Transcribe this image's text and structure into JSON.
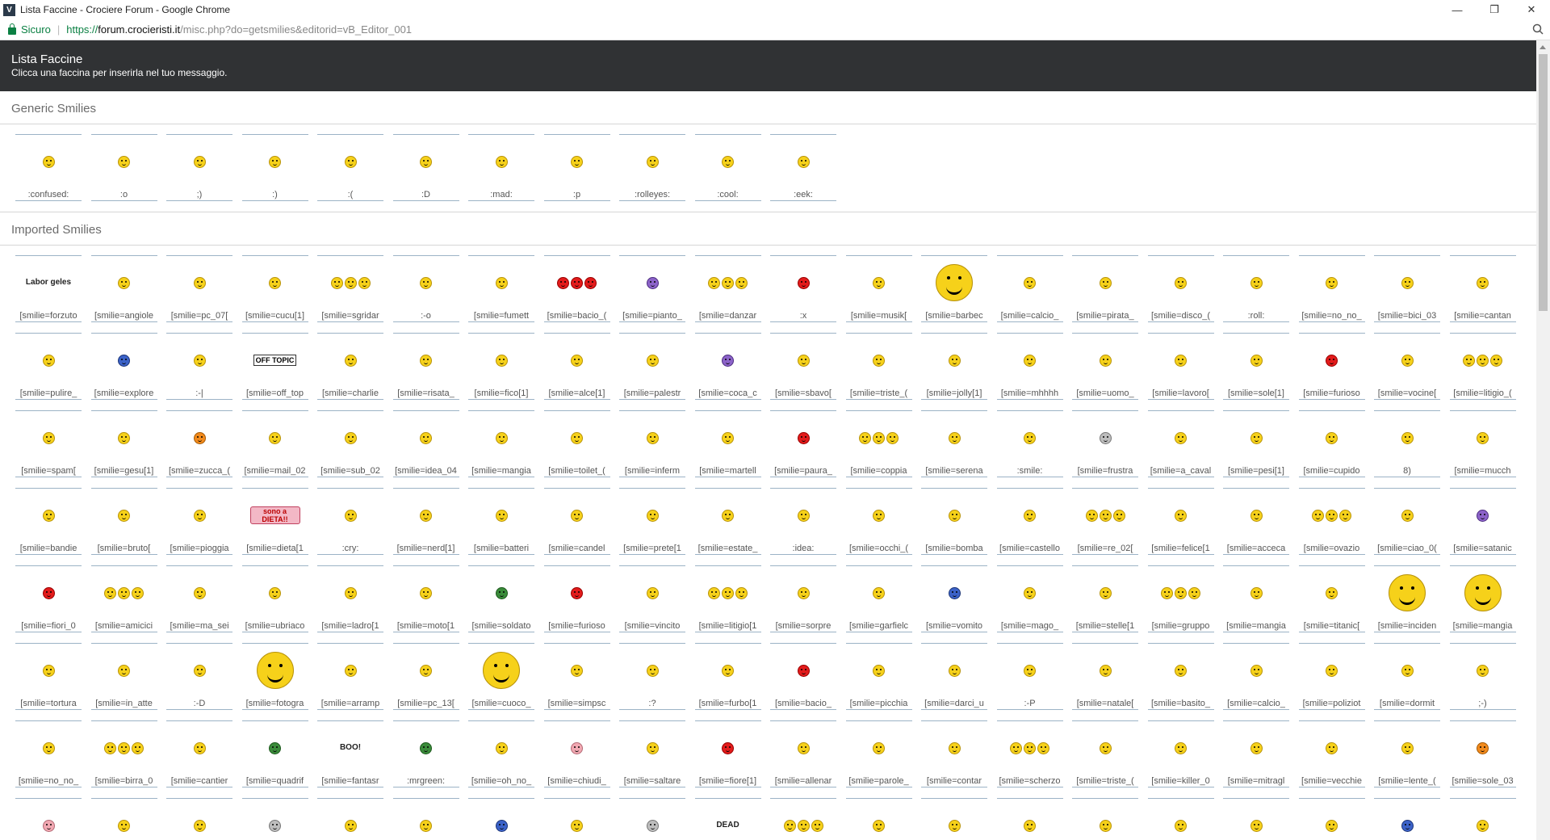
{
  "window": {
    "title": "Lista Faccine - Crociere Forum - Google Chrome",
    "app_icon": "V"
  },
  "addressbar": {
    "secure_label": "Sicuro",
    "url_scheme": "https://",
    "url_host": "forum.crocieristi.it",
    "url_path": "/misc.php?do=getsmilies&editorid=vB_Editor_001"
  },
  "header": {
    "title": "Lista Faccine",
    "subtitle": "Clicca una faccina per inserirla nel tuo messaggio."
  },
  "sections": [
    {
      "title": "Generic Smilies",
      "items": [
        {
          "code": ":confused:",
          "icon": "confused-smiley-icon"
        },
        {
          "code": ":o",
          "icon": "surprised-smiley-icon"
        },
        {
          "code": ";)",
          "icon": "wink-smiley-icon"
        },
        {
          "code": ":)",
          "icon": "smile-smiley-icon"
        },
        {
          "code": ":(",
          "icon": "frown-smiley-icon"
        },
        {
          "code": ":D",
          "icon": "grin-smiley-icon"
        },
        {
          "code": ":mad:",
          "icon": "mad-smiley-icon"
        },
        {
          "code": ":p",
          "icon": "tongue-smiley-icon"
        },
        {
          "code": ":rolleyes:",
          "icon": "rolleyes-smiley-icon"
        },
        {
          "code": ":cool:",
          "icon": "cool-smiley-icon"
        },
        {
          "code": ":eek:",
          "icon": "eek-smiley-icon"
        }
      ]
    },
    {
      "title": "Imported Smilies",
      "items": [
        {
          "code": "[smilie=forzuto",
          "icon": "laborgeles-smiley-icon",
          "text": "Labor geles"
        },
        {
          "code": "[smilie=angiole",
          "icon": "angel-smiley-icon"
        },
        {
          "code": "[smilie=pc_07[",
          "icon": "computer-smiley-icon"
        },
        {
          "code": "[smilie=cucu[1]",
          "icon": "cuckoo-clock-icon"
        },
        {
          "code": "[smilie=sgridar",
          "icon": "scolding-smileys-icon"
        },
        {
          "code": ":-o",
          "icon": "surprised-smiley-icon"
        },
        {
          "code": "[smilie=fumett",
          "icon": "comic-smiley-icon"
        },
        {
          "code": "[smilie=bacio_(",
          "icon": "kiss-smileys-icon"
        },
        {
          "code": "[smilie=pianto_",
          "icon": "crying-smiley-icon"
        },
        {
          "code": "[smilie=danzar",
          "icon": "dancing-smileys-icon"
        },
        {
          "code": ":x",
          "icon": "angry-smiley-icon"
        },
        {
          "code": "[smilie=musik[",
          "icon": "music-smiley-icon"
        },
        {
          "code": "[smilie=barbec",
          "icon": "barbecue-smiley-icon"
        },
        {
          "code": "[smilie=calcio_",
          "icon": "soccer-smiley-icon"
        },
        {
          "code": "[smilie=pirata_",
          "icon": "pirate-smiley-icon"
        },
        {
          "code": "[smilie=disco_(",
          "icon": "disco-smiley-icon"
        },
        {
          "code": ":roll:",
          "icon": "roll-eyes-smiley-icon"
        },
        {
          "code": "[smilie=no_no_",
          "icon": "no-no-smiley-icon"
        },
        {
          "code": "[smilie=bici_03",
          "icon": "bicycle-smiley-icon"
        },
        {
          "code": "[smilie=cantan",
          "icon": "singing-smiley-icon"
        },
        {
          "code": "[smilie=pulire_",
          "icon": "picture-frame-icon"
        },
        {
          "code": "[smilie=explore",
          "icon": "explorer-globe-icon"
        },
        {
          "code": ":-|",
          "icon": "neutral-smiley-icon"
        },
        {
          "code": "[smilie=off_top",
          "icon": "off-topic-sign-icon",
          "text": "OFF TOPIC"
        },
        {
          "code": "[smilie=charlie",
          "icon": "charlie-chaplin-smiley-icon"
        },
        {
          "code": "[smilie=risata_",
          "icon": "laughing-smiley-icon"
        },
        {
          "code": "[smilie=fico[1]",
          "icon": "cool-smiley-icon"
        },
        {
          "code": "[smilie=alce[1]",
          "icon": "moose-smiley-icon"
        },
        {
          "code": "[smilie=palestr",
          "icon": "gym-smiley-icon"
        },
        {
          "code": "[smilie=coca_c",
          "icon": "cola-smiley-icon"
        },
        {
          "code": "[smilie=sbavo[",
          "icon": "drool-smiley-icon"
        },
        {
          "code": "[smilie=triste_(",
          "icon": "sad-smiley-icon"
        },
        {
          "code": "[smilie=jolly[1]",
          "icon": "jester-smiley-icon"
        },
        {
          "code": "[smilie=mhhhh",
          "icon": "thinking-smiley-icon"
        },
        {
          "code": "[smilie=uomo_",
          "icon": "man-smiley-icon"
        },
        {
          "code": "[smilie=lavoro[",
          "icon": "working-smiley-icon"
        },
        {
          "code": "[smilie=sole[1]",
          "icon": "sun-smiley-icon"
        },
        {
          "code": "[smilie=furioso",
          "icon": "furious-smiley-icon"
        },
        {
          "code": "[smilie=vocine[",
          "icon": "voices-smiley-icon"
        },
        {
          "code": "[smilie=litigio_(",
          "icon": "fight-smileys-icon"
        },
        {
          "code": "[smilie=spam[",
          "icon": "spam-smiley-icon"
        },
        {
          "code": "[smilie=gesu[1]",
          "icon": "jesus-smiley-icon"
        },
        {
          "code": "[smilie=zucca_(",
          "icon": "pumpkin-icon"
        },
        {
          "code": "[smilie=mail_02",
          "icon": "mail-smiley-icon"
        },
        {
          "code": "[smilie=sub_02",
          "icon": "submarine-smiley-icon"
        },
        {
          "code": "[smilie=idea_04",
          "icon": "idea-smiley-icon"
        },
        {
          "code": "[smilie=mangia",
          "icon": "eating-smiley-icon"
        },
        {
          "code": "[smilie=toilet_(",
          "icon": "toilet-smiley-icon"
        },
        {
          "code": "[smilie=inferm",
          "icon": "nurse-smiley-icon"
        },
        {
          "code": "[smilie=martell",
          "icon": "hammer-smiley-icon"
        },
        {
          "code": "[smilie=paura_",
          "icon": "scared-smiley-icon"
        },
        {
          "code": "[smilie=coppia",
          "icon": "couple-smileys-icon"
        },
        {
          "code": "[smilie=serena",
          "icon": "serenade-smiley-icon"
        },
        {
          "code": ":smile:",
          "icon": "smile-smiley-icon"
        },
        {
          "code": "[smilie=frustra",
          "icon": "frustrated-smiley-icon"
        },
        {
          "code": "[smilie=a_caval",
          "icon": "horse-smiley-icon"
        },
        {
          "code": "[smilie=pesi[1]",
          "icon": "weights-smiley-icon"
        },
        {
          "code": "[smilie=cupido",
          "icon": "cupid-smiley-icon"
        },
        {
          "code": "8)",
          "icon": "cool-smiley-icon"
        },
        {
          "code": "[smilie=mucch",
          "icon": "cow-smiley-icon"
        },
        {
          "code": "[smilie=bandie",
          "icon": "flag-smiley-icon"
        },
        {
          "code": "[smilie=bruto[",
          "icon": "brute-smiley-icon"
        },
        {
          "code": "[smilie=pioggia",
          "icon": "rain-umbrella-smiley-icon"
        },
        {
          "code": "[smilie=dieta[1",
          "icon": "diet-sign-icon",
          "text": "sono a DIETA!!"
        },
        {
          "code": ":cry:",
          "icon": "cry-smiley-icon"
        },
        {
          "code": "[smilie=nerd[1]",
          "icon": "nerd-smiley-icon"
        },
        {
          "code": "[smilie=batteri",
          "icon": "drummer-smiley-icon"
        },
        {
          "code": "[smilie=candel",
          "icon": "candle-smiley-icon"
        },
        {
          "code": "[smilie=prete[1",
          "icon": "priest-smiley-icon"
        },
        {
          "code": "[smilie=estate_",
          "icon": "summer-smiley-icon"
        },
        {
          "code": ":idea:",
          "icon": "lightbulb-smiley-icon"
        },
        {
          "code": "[smilie=occhi_(",
          "icon": "eyes-smiley-icon"
        },
        {
          "code": "[smilie=bomba",
          "icon": "bomb-smiley-icon"
        },
        {
          "code": "[smilie=castello",
          "icon": "castle-icon"
        },
        {
          "code": "[smilie=re_02[",
          "icon": "king-smileys-icon"
        },
        {
          "code": "[smilie=felice[1",
          "icon": "happy-smiley-icon"
        },
        {
          "code": "[smilie=acceca",
          "icon": "blinded-smiley-icon"
        },
        {
          "code": "[smilie=ovazio",
          "icon": "ovation-smileys-icon"
        },
        {
          "code": "[smilie=ciao_0(",
          "icon": "waving-smiley-icon"
        },
        {
          "code": "[smilie=satanic",
          "icon": "devil-smiley-icon"
        },
        {
          "code": "[smilie=fiori_0",
          "icon": "flowers-smiley-icon"
        },
        {
          "code": "[smilie=amicici",
          "icon": "friends-smileys-icon"
        },
        {
          "code": "[smilie=ma_sei",
          "icon": "are-you-smiley-icon"
        },
        {
          "code": "[smilie=ubriaco",
          "icon": "drunk-smiley-icon"
        },
        {
          "code": "[smilie=ladro[1",
          "icon": "thief-smiley-icon"
        },
        {
          "code": "[smilie=moto[1",
          "icon": "motorbike-smiley-icon"
        },
        {
          "code": "[smilie=soldato",
          "icon": "soldier-smiley-icon"
        },
        {
          "code": "[smilie=furioso",
          "icon": "furious-smiley-icon"
        },
        {
          "code": "[smilie=vincito",
          "icon": "winner-smiley-icon"
        },
        {
          "code": "[smilie=litigio[1",
          "icon": "argue-smileys-icon"
        },
        {
          "code": "[smilie=sorpre",
          "icon": "surprise-smiley-icon"
        },
        {
          "code": "[smilie=garfielc",
          "icon": "garfield-icon"
        },
        {
          "code": "[smilie=vomito",
          "icon": "vomit-smiley-icon"
        },
        {
          "code": "[smilie=mago_",
          "icon": "wizard-smiley-icon"
        },
        {
          "code": "[smilie=stelle[1",
          "icon": "stars-smiley-icon"
        },
        {
          "code": "[smilie=gruppo",
          "icon": "group-smileys-icon"
        },
        {
          "code": "[smilie=mangia",
          "icon": "eating-smiley-icon"
        },
        {
          "code": "[smilie=titanic[",
          "icon": "titanic-ship-icon"
        },
        {
          "code": "[smilie=inciden",
          "icon": "accident-smiley-icon"
        },
        {
          "code": "[smilie=mangia",
          "icon": "big-eating-smiley-icon"
        },
        {
          "code": "[smilie=tortura",
          "icon": "torture-smiley-icon"
        },
        {
          "code": "[smilie=in_atte",
          "icon": "waiting-smiley-icon"
        },
        {
          "code": ":-D",
          "icon": "grin-smiley-icon"
        },
        {
          "code": "[smilie=fotogra",
          "icon": "photographer-smiley-icon"
        },
        {
          "code": "[smilie=arramp",
          "icon": "climbing-smiley-icon"
        },
        {
          "code": "[smilie=pc_13[",
          "icon": "computer-smiley-icon"
        },
        {
          "code": "[smilie=cuoco_",
          "icon": "cook-smiley-icon"
        },
        {
          "code": "[smilie=simpsc",
          "icon": "simpson-icon"
        },
        {
          "code": ":?",
          "icon": "confused-smiley-icon"
        },
        {
          "code": "[smilie=furbo[1",
          "icon": "sly-smiley-icon"
        },
        {
          "code": "[smilie=bacio_",
          "icon": "lips-kiss-icon"
        },
        {
          "code": "[smilie=picchia",
          "icon": "hitting-smiley-icon"
        },
        {
          "code": "[smilie=darci_u",
          "icon": "cheers-smiley-icon"
        },
        {
          "code": ":-P",
          "icon": "tongue-smiley-icon"
        },
        {
          "code": "[smilie=natale[",
          "icon": "christmas-icon"
        },
        {
          "code": "[smilie=basito_",
          "icon": "stunned-tall-smiley-icon"
        },
        {
          "code": "[smilie=calcio_",
          "icon": "italy-flag-smiley-icon"
        },
        {
          "code": "[smilie=poliziot",
          "icon": "police-smiley-icon"
        },
        {
          "code": "[smilie=dormit",
          "icon": "sleeping-smiley-icon"
        },
        {
          "code": ";-)",
          "icon": "wink-smiley-icon"
        },
        {
          "code": "[smilie=no_no_",
          "icon": "no-no-smiley-icon"
        },
        {
          "code": "[smilie=birra_0",
          "icon": "beer-smileys-icon"
        },
        {
          "code": "[smilie=cantier",
          "icon": "construction-smiley-icon"
        },
        {
          "code": "[smilie=quadrif",
          "icon": "clover-icon"
        },
        {
          "code": "[smilie=fantasr",
          "icon": "ghost-boo-icon",
          "text": "BOO!"
        },
        {
          "code": ":mrgreen:",
          "icon": "mrgreen-smiley-icon"
        },
        {
          "code": "[smilie=oh_no_",
          "icon": "oh-no-smiley-icon"
        },
        {
          "code": "[smilie=chiudi_",
          "icon": "close-smiley-icon"
        },
        {
          "code": "[smilie=saltare",
          "icon": "jumping-smiley-icon"
        },
        {
          "code": "[smilie=fiore[1]",
          "icon": "flower-icon"
        },
        {
          "code": "[smilie=allenar",
          "icon": "treadmill-smiley-icon"
        },
        {
          "code": "[smilie=parole_",
          "icon": "words-sign-smiley-icon"
        },
        {
          "code": "[smilie=contar",
          "icon": "counting-smiley-icon"
        },
        {
          "code": "[smilie=scherzo",
          "icon": "joke-smileys-icon"
        },
        {
          "code": "[smilie=triste_(",
          "icon": "sad-smiley-icon"
        },
        {
          "code": "[smilie=killer_0",
          "icon": "axe-killer-icon"
        },
        {
          "code": "[smilie=mitragl",
          "icon": "machine-gun-smiley-icon"
        },
        {
          "code": "[smilie=vecchie",
          "icon": "old-smiley-icon"
        },
        {
          "code": "[smilie=lente_(",
          "icon": "magnifier-smiley-icon"
        },
        {
          "code": "[smilie=sole_03",
          "icon": "sun-icon"
        },
        {
          "code": "",
          "icon": "pink-smiley-icon"
        },
        {
          "code": "",
          "icon": "cat-smiley-icon"
        },
        {
          "code": "",
          "icon": "hat-smiley-icon"
        },
        {
          "code": "",
          "icon": "stick-icon"
        },
        {
          "code": "",
          "icon": "bandit-smiley-icon"
        },
        {
          "code": "",
          "icon": "sign-smiley-icon"
        },
        {
          "code": "",
          "icon": "mouse-smiley-icon"
        },
        {
          "code": "",
          "icon": "hanging-smiley-icon"
        },
        {
          "code": "",
          "icon": "blank-icon"
        },
        {
          "code": "",
          "icon": "dead-tombstone-icon",
          "text": "DEAD"
        },
        {
          "code": "",
          "icon": "trio-smileys-icon"
        },
        {
          "code": "",
          "icon": "glasses-smiley-icon"
        },
        {
          "code": "",
          "icon": "ball-smiley-icon"
        },
        {
          "code": "",
          "icon": "small-smiley-icon"
        },
        {
          "code": "",
          "icon": "cowboy-smiley-icon"
        },
        {
          "code": "",
          "icon": "boxing-smiley-icon"
        },
        {
          "code": "",
          "icon": "tiny-smiley-icon"
        },
        {
          "code": "",
          "icon": "lying-smiley-icon"
        },
        {
          "code": "",
          "icon": "blue-bow-smiley-icon"
        },
        {
          "code": "",
          "icon": "sparkle-smiley-icon"
        }
      ]
    }
  ],
  "colors": {
    "header_bg": "#303234",
    "cell_border": "#9cb3c6",
    "smiley_yellow": "#f6d11a",
    "secure_green": "#0b8043"
  }
}
